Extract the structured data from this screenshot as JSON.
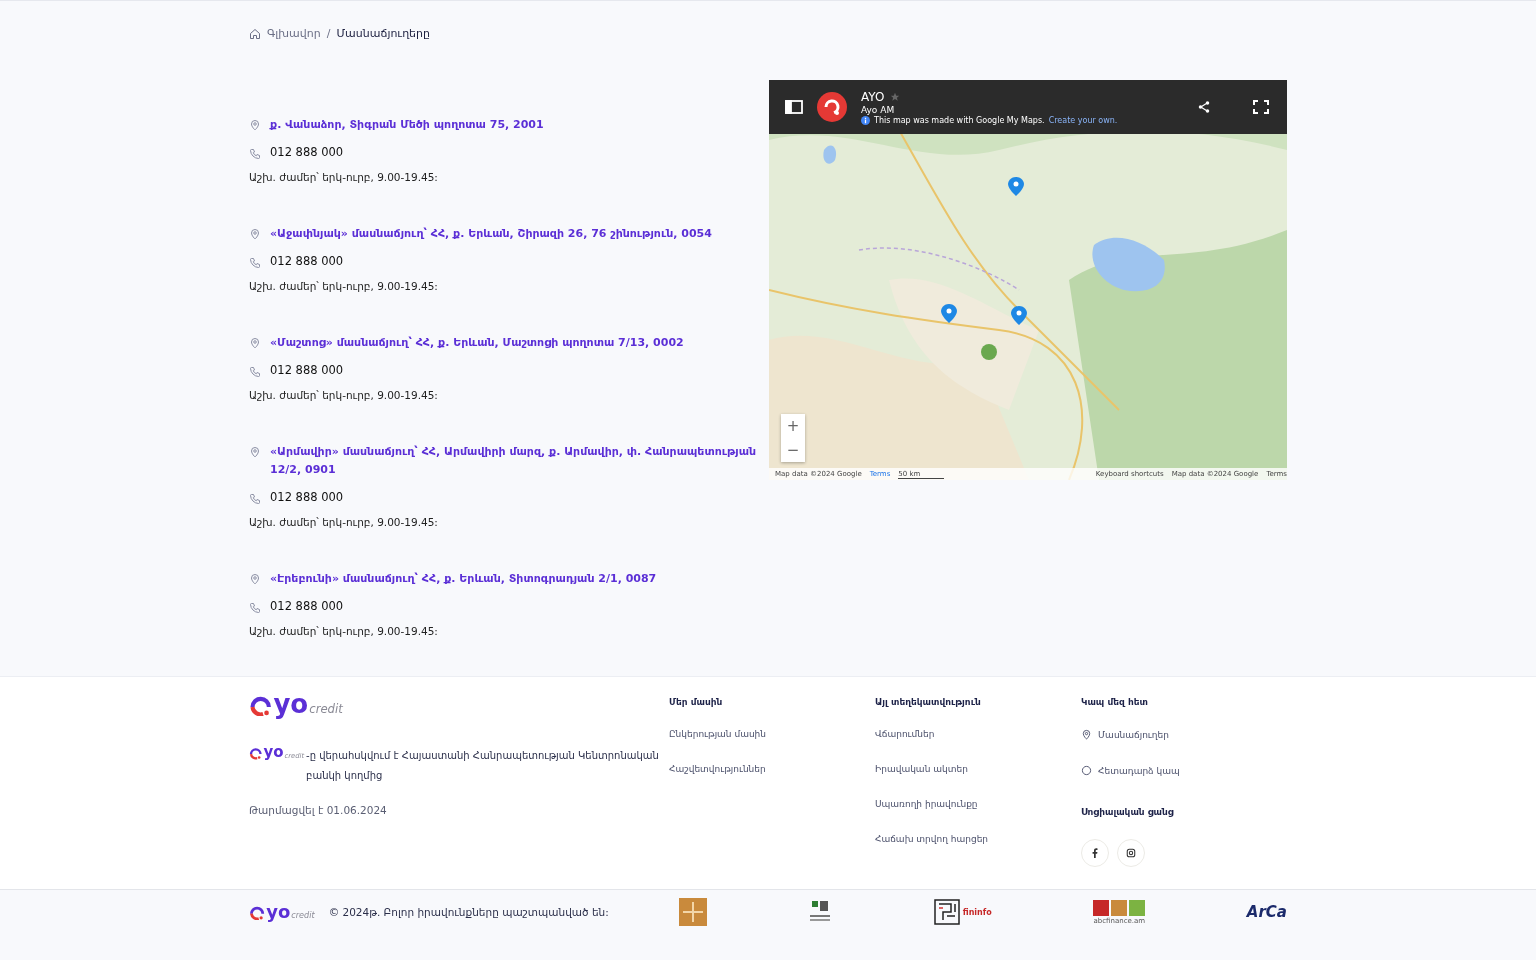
{
  "breadcrumb": [
    {
      "label": "Գլխավոր",
      "current": false
    },
    {
      "label": "Մասնաճյուղերը",
      "current": true
    }
  ],
  "branches": [
    {
      "address": "ք. Վանաձոր, Տիգրան Մեծի պողոտա 75, 2001",
      "phone": "012 888 000",
      "hours": "Աշխ. ժամեր՝ երկ-ուրբ, 9.00-19.45:"
    },
    {
      "address": "«Աջափնյակ» մասնաճյուղ՝ ՀՀ, ք. Երևան, Շիրազի 26, 76 շինություն, 0054",
      "phone": "012 888 000",
      "hours": "Աշխ. ժամեր՝ երկ-ուրբ, 9.00-19.45:"
    },
    {
      "address": "«Մաշտոց» մասնաճյուղ՝ ՀՀ, ք. Երևան, Մաշտոցի պողոտա 7/13, 0002",
      "phone": "012 888 000",
      "hours": "Աշխ. ժամեր՝ երկ-ուրբ, 9.00-19.45:"
    },
    {
      "address": "«Արմավիր» մասնաճյուղ՝ ՀՀ, Արմավիրի մարզ, ք. Արմավիր, փ. Հանրապետության 12/2, 0901",
      "phone": "012 888 000",
      "hours": "Աշխ. ժամեր՝ երկ-ուրբ, 9.00-19.45:"
    },
    {
      "address": "«Էրեբունի» մասնաճյուղ՝ ՀՀ, ք. Երևան, Տիտոգրադյան 2/1, 0087",
      "phone": "012 888 000",
      "hours": "Աշխ. ժամեր՝ երկ-ուրբ, 9.00-19.45:"
    }
  ],
  "map": {
    "title": "AYO",
    "subtitle": "Ayo AM",
    "notice": "This map was made with Google My Maps.",
    "notice_link": "Create your own.",
    "zoom_in": "+",
    "zoom_out": "−",
    "attribution": [
      {
        "kind": "text",
        "label": "Map data ©2024 Google"
      },
      {
        "kind": "link",
        "label": "Terms"
      },
      {
        "kind": "scale",
        "label": "50 km"
      },
      {
        "kind": "text",
        "label": "Keyboard shortcuts"
      },
      {
        "kind": "text",
        "label": "Map data ©2024 Google"
      },
      {
        "kind": "text",
        "label": "Terms"
      }
    ]
  },
  "breadcrumb_separator": "/",
  "footer": {
    "logos": [
      {
        "word": "yo",
        "suffix": "credit"
      },
      {
        "word": "yo",
        "suffix": "credit"
      },
      {
        "word": "yo",
        "suffix": "credit"
      }
    ],
    "notice": "-ը վերահսկվում է Հայաստանի Հանրապետության Կենտրոնական բանկի կողմից",
    "updated": "Թարմացվել է 01.06.2024",
    "columns": [
      {
        "title": "Մեր մասին",
        "links": [
          {
            "label": "Ընկերության մասին"
          },
          {
            "label": "Հաշվետվություններ"
          }
        ]
      },
      {
        "title": "Այլ տեղեկատվություն",
        "links": [
          {
            "label": "Վճարումներ"
          },
          {
            "label": "Իրավական ակտեր"
          },
          {
            "label": "Սպառողի իրավունքը"
          },
          {
            "label": "Հաճախ տրվող հարցեր"
          }
        ]
      },
      {
        "title": "Կապ մեզ հետ",
        "links": [
          {
            "label": "Մասնաճյուղեր",
            "kind": "pin"
          },
          {
            "label": "Հետադարձ կապ",
            "kind": "chat"
          }
        ],
        "social_title": "Սոցիալական ցանց",
        "social": [
          {
            "kind": "facebook"
          },
          {
            "kind": "instagram"
          }
        ]
      }
    ],
    "copyright": "© 2024թ. Բոլոր իրավունքները պաշտպանված են:",
    "partners": [
      {
        "kind": "tile"
      },
      {
        "kind": "fund"
      },
      {
        "kind": "fininfo",
        "label": "fininfo"
      },
      {
        "kind": "abc",
        "label": "abcfinance.am"
      },
      {
        "kind": "arca",
        "label": "ArCa"
      }
    ]
  }
}
